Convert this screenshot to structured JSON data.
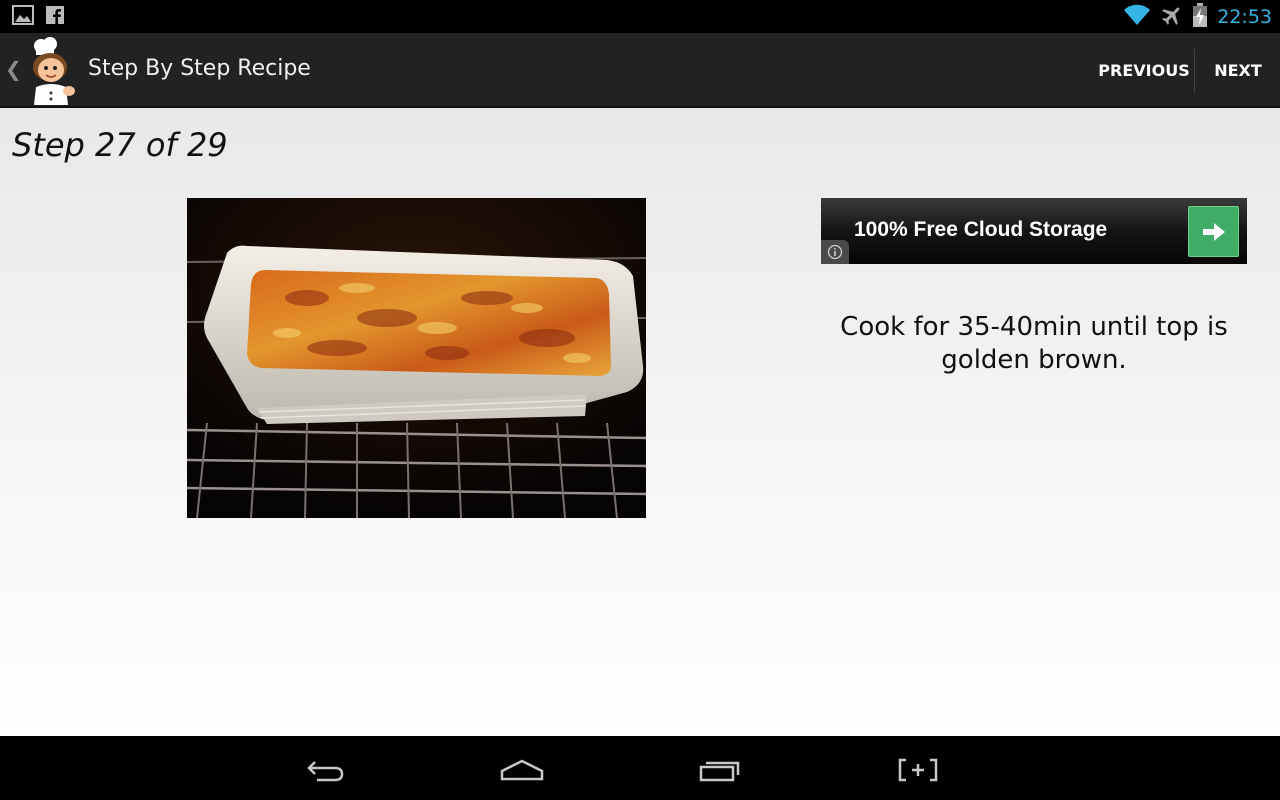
{
  "status_bar": {
    "time": "22:53",
    "left_icons": [
      "gallery-icon",
      "facebook-icon"
    ],
    "right_icons": [
      "wifi-icon",
      "airplane-mode-icon",
      "battery-charging-icon"
    ],
    "accent_color": "#33b5e5"
  },
  "action_bar": {
    "title": "Step By Step Recipe",
    "app_icon": "chef-icon",
    "previous_label": "PREVIOUS",
    "next_label": "NEXT"
  },
  "step": {
    "label": "Step 27 of 29",
    "description": "Cook for 35-40min until top is golden brown.",
    "photo": "lasagna-in-oven-photo"
  },
  "ad": {
    "text": "100% Free Cloud Storage",
    "button_icon": "arrow-right-icon",
    "info_icon": "info-icon",
    "button_color": "#3fad66"
  },
  "nav_bar": {
    "buttons": [
      "back-icon",
      "home-icon",
      "recent-apps-icon",
      "screenshot-icon"
    ]
  }
}
